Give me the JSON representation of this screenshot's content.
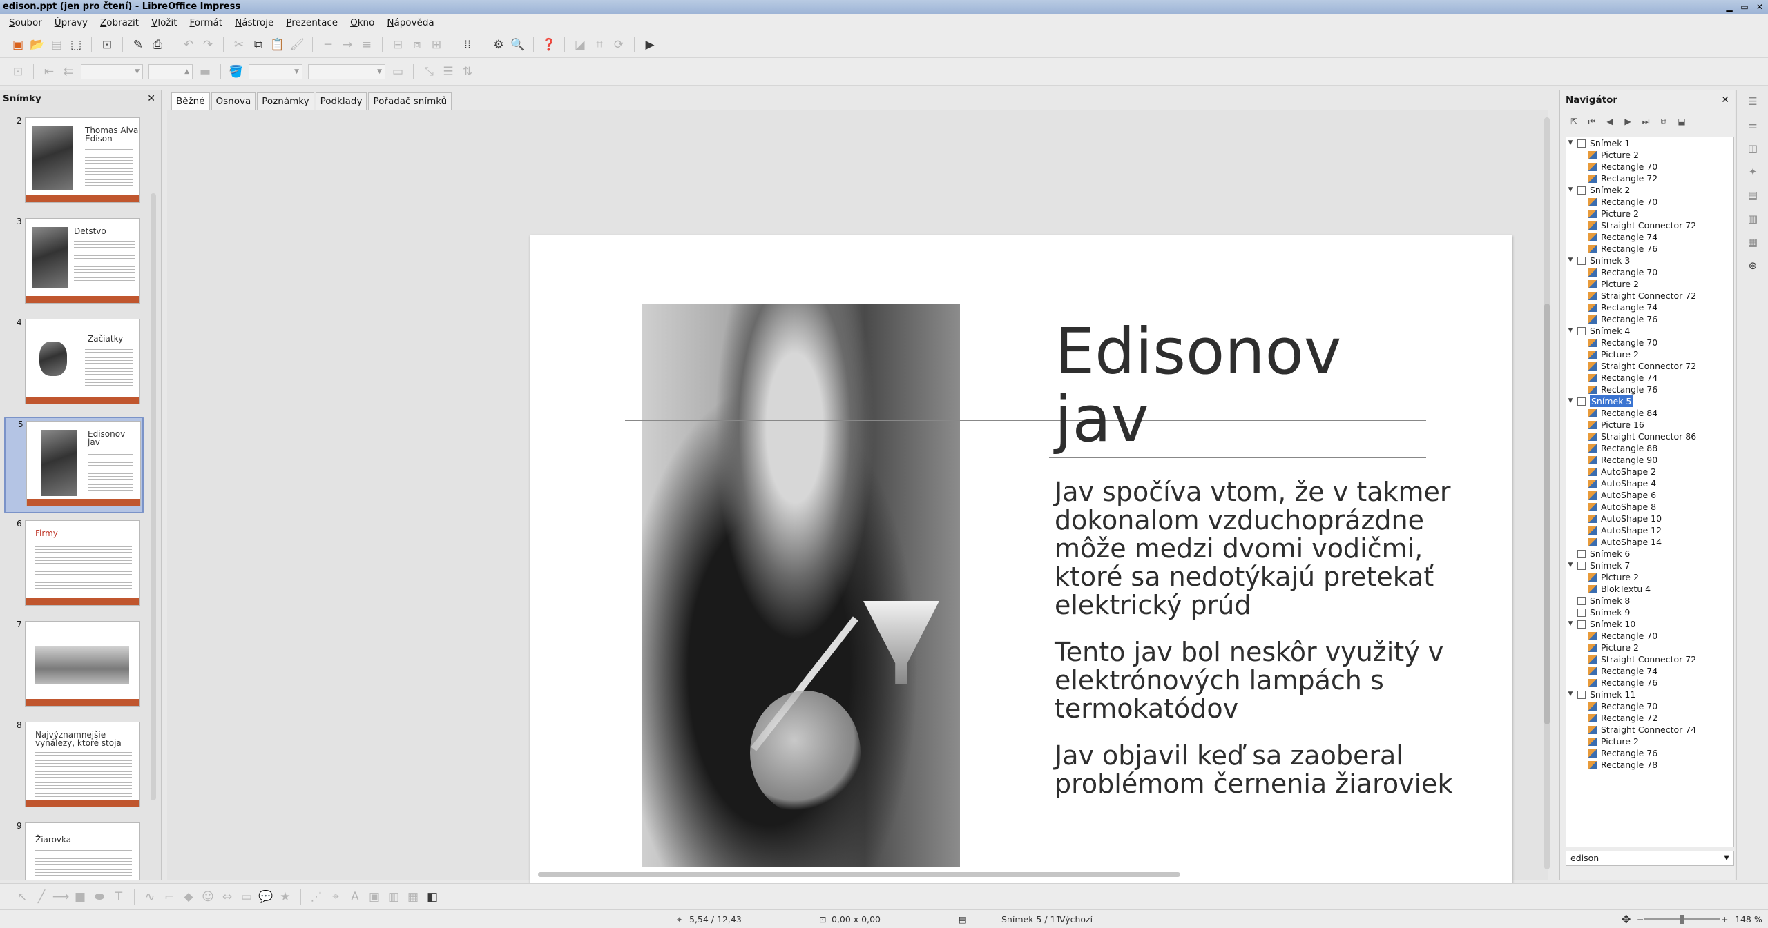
{
  "window": {
    "title": "edison.ppt (jen pro čtení) - LibreOffice Impress"
  },
  "menu": [
    "Soubor",
    "Úpravy",
    "Zobrazit",
    "Vložit",
    "Formát",
    "Nástroje",
    "Prezentace",
    "Okno",
    "Nápověda"
  ],
  "slides_panel": {
    "title": "Snímky",
    "thumbnails": [
      {
        "num": "2",
        "title": "Thomas Alva Edison"
      },
      {
        "num": "3",
        "title": "Detstvo"
      },
      {
        "num": "4",
        "title": "Začiatky"
      },
      {
        "num": "5",
        "title": "Edisonov jav"
      },
      {
        "num": "6",
        "title": "Firmy"
      },
      {
        "num": "7",
        "title": ""
      },
      {
        "num": "8",
        "title": "Najvýznamnejšie vynálezy, ktoré stoja"
      },
      {
        "num": "9",
        "title": "Žiarovka"
      }
    ]
  },
  "view_tabs": [
    "Běžné",
    "Osnova",
    "Poznámky",
    "Podklady",
    "Pořadač snímků"
  ],
  "slide": {
    "title": "Edisonov\njav",
    "paragraphs": [
      "Jav spočíva vtom, že v takmer dokonalom vzduchoprázdne môže medzi dvomi vodičmi, ktoré sa nedotýkajú pretekať elektrický prúd",
      "Tento jav bol neskôr využitý v elektrónových lampách s termokatódov",
      "Jav objavil keď sa zaoberal problémom černenia žiaroviek"
    ],
    "accent_color": "#c0562e",
    "accent_stripe_color": "#ee8a23"
  },
  "navigator": {
    "title": "Navigátor",
    "document": "edison",
    "tree": [
      {
        "label": "Snímek 1",
        "expanded": true,
        "children": [
          "Picture 2",
          "Rectangle 70",
          "Rectangle 72"
        ]
      },
      {
        "label": "Snímek 2",
        "expanded": true,
        "children": [
          "Rectangle 70",
          "Picture 2",
          "Straight Connector 72",
          "Rectangle 74",
          "Rectangle 76"
        ]
      },
      {
        "label": "Snímek 3",
        "expanded": true,
        "children": [
          "Rectangle 70",
          "Picture 2",
          "Straight Connector 72",
          "Rectangle 74",
          "Rectangle 76"
        ]
      },
      {
        "label": "Snímek 4",
        "expanded": true,
        "children": [
          "Rectangle 70",
          "Picture 2",
          "Straight Connector 72",
          "Rectangle 74",
          "Rectangle 76"
        ]
      },
      {
        "label": "Snímek 5",
        "expanded": true,
        "selected": true,
        "children": [
          "Rectangle 84",
          "Picture 16",
          "Straight Connector 86",
          "Rectangle 88",
          "Rectangle 90",
          "AutoShape 2",
          "AutoShape 4",
          "AutoShape 6",
          "AutoShape 8",
          "AutoShape 10",
          "AutoShape 12",
          "AutoShape 14"
        ]
      },
      {
        "label": "Snímek 6",
        "expanded": false,
        "children": []
      },
      {
        "label": "Snímek 7",
        "expanded": true,
        "children": [
          "Picture 2",
          "BlokTextu 4"
        ]
      },
      {
        "label": "Snímek 8",
        "expanded": false,
        "children": []
      },
      {
        "label": "Snímek 9",
        "expanded": false,
        "children": []
      },
      {
        "label": "Snímek 10",
        "expanded": true,
        "children": [
          "Rectangle 70",
          "Picture 2",
          "Straight Connector 72",
          "Rectangle 74",
          "Rectangle 76"
        ]
      },
      {
        "label": "Snímek 11",
        "expanded": true,
        "children": [
          "Rectangle 70",
          "Rectangle 72",
          "Straight Connector 74",
          "Picture 2",
          "Rectangle 76",
          "Rectangle 78"
        ]
      }
    ]
  },
  "status": {
    "position": "5,54 / 12,43",
    "size": "0,00 x 0,00",
    "slide": "Snímek 5 / 11",
    "layout": "Výchozí",
    "zoom": "148 %"
  }
}
